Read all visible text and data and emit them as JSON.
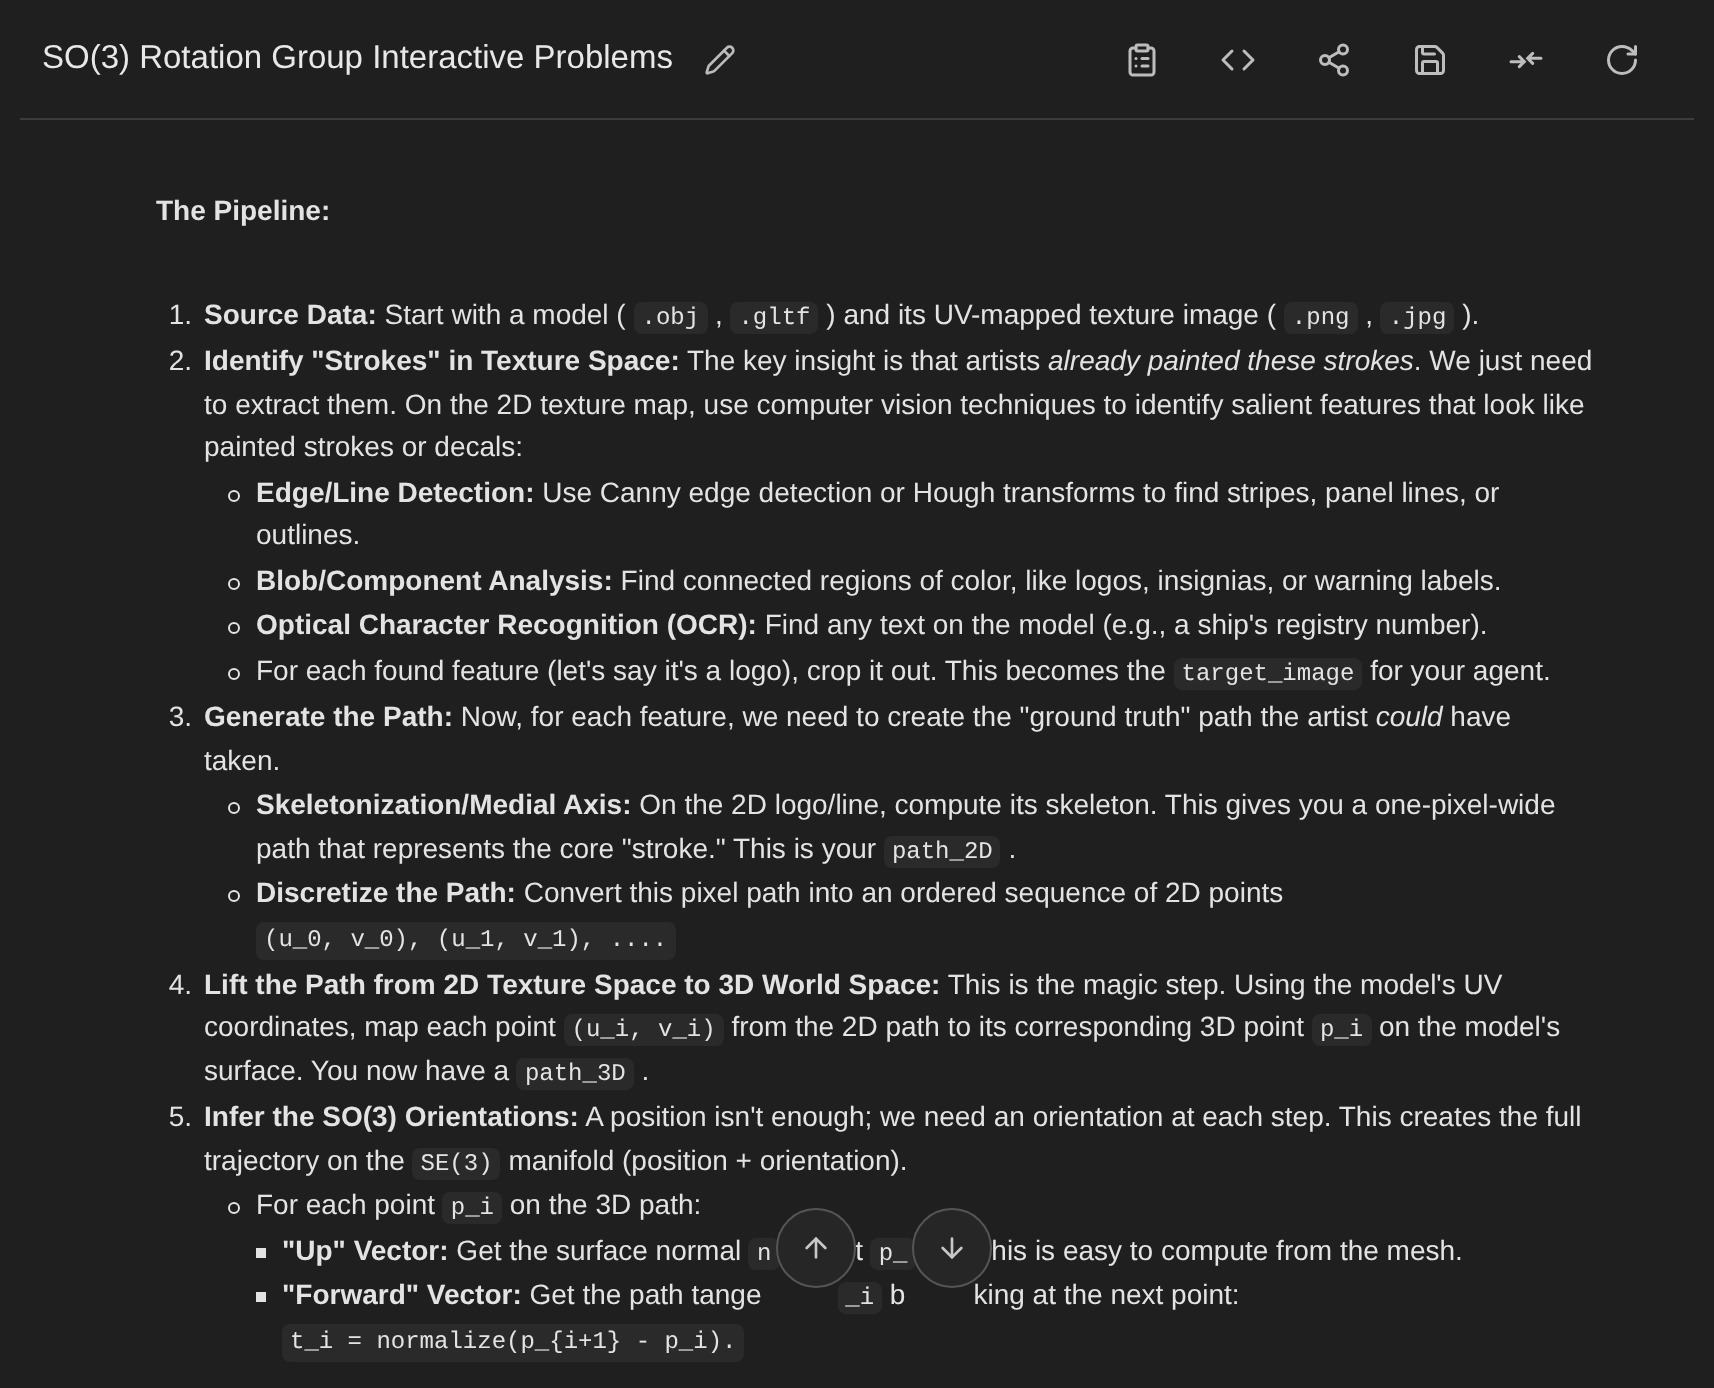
{
  "header": {
    "title": "SO(3) Rotation Group Interactive Problems"
  },
  "heading": "The Pipeline:",
  "steps": [
    {
      "number": "1.",
      "parts": [
        {
          "kind": "text",
          "text": "**Source Data:** Start with a model ("
        },
        {
          "kind": "code",
          "text": ".obj"
        },
        {
          "kind": "text",
          "text": ","
        },
        {
          "kind": "code",
          "text": ".gltf"
        },
        {
          "kind": "text",
          "text": ") and its UV-mapped texture image ("
        },
        {
          "kind": "code",
          "text": ".png"
        },
        {
          "kind": "text",
          "text": ","
        },
        {
          "kind": "code",
          "text": ".jpg"
        },
        {
          "kind": "text",
          "text": ")."
        }
      ]
    },
    {
      "number": "2.",
      "parts": [
        {
          "kind": "text",
          "text": "**Identify \"Strokes\" in Texture Space:** The key insight is that artists *already painted these strokes*. We just need to extract them. On the 2D texture map, use computer vision techniques to identify salient features that look like painted strokes or decals:"
        }
      ],
      "children": [
        {
          "parts": [
            {
              "kind": "text",
              "text": "**Edge/Line Detection:** Use Canny edge detection or Hough transforms to find stripes, panel lines, or outlines."
            }
          ]
        },
        {
          "parts": [
            {
              "kind": "text",
              "text": "**Blob/Component Analysis:** Find connected regions of color, like logos, insignias, or warning labels."
            }
          ]
        },
        {
          "parts": [
            {
              "kind": "text",
              "text": "**Optical Character Recognition (OCR):** Find any text on the model (e.g., a ship's registry number)."
            }
          ]
        },
        {
          "parts": [
            {
              "kind": "text",
              "text": "For each found feature (let's say it's a logo), crop it out. This becomes the"
            },
            {
              "kind": "code",
              "text": "target_image"
            },
            {
              "kind": "text",
              "text": "for your agent."
            }
          ]
        }
      ]
    },
    {
      "number": "3.",
      "parts": [
        {
          "kind": "text",
          "text": "**Generate the Path:** Now, for each feature, we need to create the \"ground truth\" path the artist *could* have taken."
        }
      ],
      "children": [
        {
          "parts": [
            {
              "kind": "text",
              "text": "**Skeletonization/Medial Axis:** On the 2D logo/line, compute its skeleton. This gives you a one-pixel-wide path that represents the core \"stroke.\" This is your"
            },
            {
              "kind": "code",
              "text": "path_2D"
            },
            {
              "kind": "text",
              "text": "."
            }
          ]
        },
        {
          "parts": [
            {
              "kind": "text",
              "text": "**Discretize the Path:** Convert this pixel path into an ordered sequence of 2D points"
            },
            {
              "kind": "code",
              "text": "(u_0, v_0), (u_1, v_1), ...."
            }
          ]
        }
      ]
    },
    {
      "number": "4.",
      "parts": [
        {
          "kind": "text",
          "text": "**Lift the Path from 2D Texture Space to 3D World Space:** This is the magic step. Using the model's UV coordinates, map each point"
        },
        {
          "kind": "code",
          "text": "(u_i, v_i)"
        },
        {
          "kind": "text",
          "text": "from the 2D path to its corresponding 3D point"
        },
        {
          "kind": "code",
          "text": "p_i"
        },
        {
          "kind": "text",
          "text": "on the model's surface. You now have a"
        },
        {
          "kind": "code",
          "text": "path_3D"
        },
        {
          "kind": "text",
          "text": "."
        }
      ]
    },
    {
      "number": "5.",
      "parts": [
        {
          "kind": "text",
          "text": "**Infer the SO(3) Orientations:** A position isn't enough; we need an orientation at each step. This creates the full trajectory on the"
        },
        {
          "kind": "code",
          "text": "SE(3)"
        },
        {
          "kind": "text",
          "text": "manifold (position + orientation)."
        }
      ],
      "children": [
        {
          "parts": [
            {
              "kind": "text",
              "text": "For each point"
            },
            {
              "kind": "code",
              "text": "p_i"
            },
            {
              "kind": "text",
              "text": "on the 3D path:"
            }
          ],
          "children": [
            {
              "parts": [
                {
                  "kind": "text",
                  "text": "**\"Up\" Vector:** Get the surface normal"
                },
                {
                  "kind": "code",
                  "text": "n"
                },
                {
                  "kind": "gap"
                },
                {
                  "kind": "text",
                  "text": "t"
                },
                {
                  "kind": "code",
                  "text": "p_"
                },
                {
                  "kind": "gap"
                },
                {
                  "kind": "text",
                  "text": "his is easy to compute from the mesh."
                }
              ]
            },
            {
              "parts": [
                {
                  "kind": "text",
                  "text": "**\"Forward\" Vector:** Get the path tange"
                },
                {
                  "kind": "gap"
                },
                {
                  "kind": "code",
                  "text": "_i"
                },
                {
                  "kind": "text",
                  "text": "b"
                },
                {
                  "kind": "gap"
                },
                {
                  "kind": "text",
                  "text": "king at the next point:"
                },
                {
                  "kind": "code",
                  "text": "t_i = normalize(p_{i+1} - p_i)."
                }
              ]
            }
          ]
        }
      ]
    }
  ],
  "scroll_buttons": [
    {
      "kind": "up"
    },
    {
      "kind": "down"
    }
  ]
}
